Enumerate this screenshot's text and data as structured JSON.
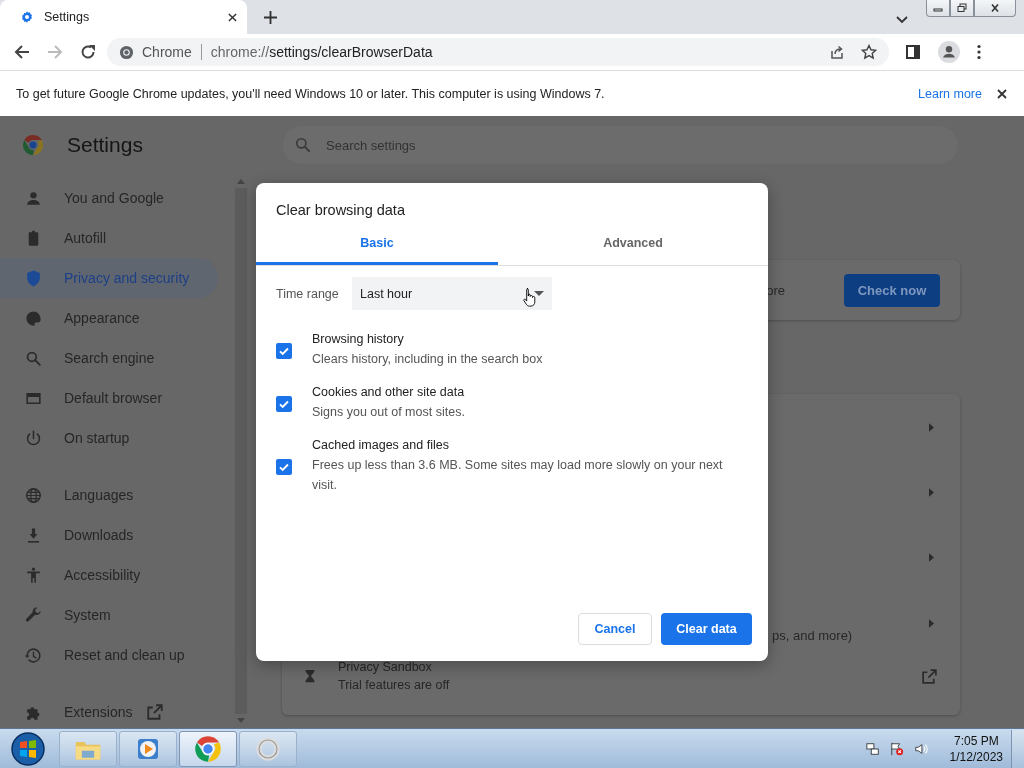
{
  "browser_tab": {
    "title": "Settings"
  },
  "toolbar": {
    "forward_disabled": true,
    "site_label": "Chrome",
    "url_scheme": "chrome://",
    "url_path": "settings/clearBrowserData"
  },
  "infobar": {
    "message": "To get future Google Chrome updates, you'll need Windows 10 or later. This computer is using Windows 7.",
    "link": "Learn more"
  },
  "settings": {
    "title": "Settings",
    "search_placeholder": "Search settings",
    "sidebar": [
      {
        "label": "You and Google",
        "selected": false
      },
      {
        "label": "Autofill",
        "selected": false
      },
      {
        "label": "Privacy and security",
        "selected": true
      },
      {
        "label": "Appearance",
        "selected": false
      },
      {
        "label": "Search engine",
        "selected": false
      },
      {
        "label": "Default browser",
        "selected": false
      },
      {
        "label": "On startup",
        "selected": false
      },
      {
        "label": "Languages",
        "selected": false
      },
      {
        "label": "Downloads",
        "selected": false
      },
      {
        "label": "Accessibility",
        "selected": false
      },
      {
        "label": "System",
        "selected": false
      },
      {
        "label": "Reset and clean up",
        "selected": false
      },
      {
        "label": "Extensions",
        "selected": false
      }
    ],
    "safety_fragment": "ore",
    "check_button": "Check now",
    "rows_fragment": "ps, and more)",
    "sandbox": {
      "title": "Privacy Sandbox",
      "subtitle": "Trial features are off"
    }
  },
  "dialog": {
    "title": "Clear browsing data",
    "tabs": [
      {
        "label": "Basic",
        "selected": true
      },
      {
        "label": "Advanced",
        "selected": false
      }
    ],
    "time_range": {
      "label": "Time range",
      "value": "Last hour"
    },
    "items": [
      {
        "title": "Browsing history",
        "description": "Clears history, including in the search box",
        "checked": true
      },
      {
        "title": "Cookies and other site data",
        "description": "Signs you out of most sites.",
        "checked": true
      },
      {
        "title": "Cached images and files",
        "description": "Frees up less than 3.6 MB. Some sites may load more slowly on your next visit.",
        "checked": true
      }
    ],
    "cancel": "Cancel",
    "confirm": "Clear data"
  },
  "taskbar": {
    "apps": [
      {
        "selected": false
      },
      {
        "selected": false
      },
      {
        "selected": true
      },
      {
        "selected": false
      }
    ],
    "time": "7:05 PM",
    "date": "1/12/2023"
  }
}
